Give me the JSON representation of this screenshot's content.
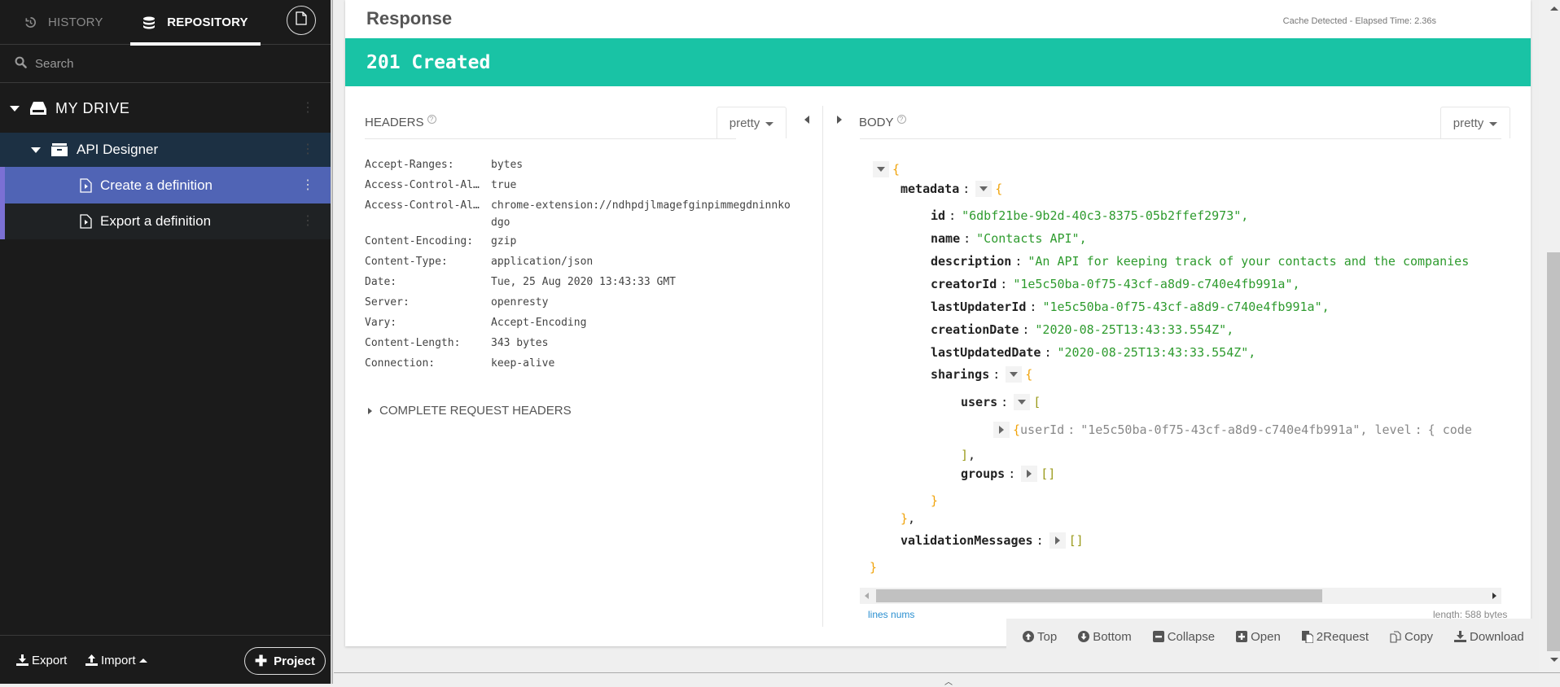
{
  "sidebar": {
    "tabs": [
      {
        "label": "HISTORY",
        "icon": "history-icon",
        "active": false
      },
      {
        "label": "REPOSITORY",
        "icon": "database-icon",
        "active": true
      }
    ],
    "new_doc_icon": "new-document-icon",
    "search": {
      "placeholder": "Search",
      "value": ""
    },
    "tree": {
      "drive": {
        "label": "MY DRIVE",
        "icon": "drive-icon",
        "expanded": true
      },
      "project": {
        "label": "API Designer",
        "icon": "project-box-icon",
        "expanded": true
      },
      "requests": [
        {
          "label": "Create a definition",
          "icon": "request-file-icon",
          "selected": true
        },
        {
          "label": "Export a definition",
          "icon": "request-file-icon",
          "selected": false
        }
      ]
    },
    "footer": {
      "export_label": "Export",
      "import_label": "Import",
      "project_label": "Project"
    }
  },
  "response": {
    "title": "Response",
    "elapsed": "Cache Detected - Elapsed Time: 2.36s",
    "status": "201 Created",
    "status_color": "#19c3a5",
    "headers": {
      "title": "HEADERS",
      "format": "pretty",
      "rows": [
        {
          "key": "Accept-Ranges:",
          "value": "bytes"
        },
        {
          "key": "Access-Control-Al…",
          "value": "true"
        },
        {
          "key": "Access-Control-Al…",
          "value": "chrome-extension://ndhpdjlmagefginpimmegdninnkodgo"
        },
        {
          "key": "Content-Encoding:",
          "value": "gzip"
        },
        {
          "key": "Content-Type:",
          "value": "application/json"
        },
        {
          "key": "Date:",
          "value": "Tue, 25 Aug 2020 13:43:33 GMT"
        },
        {
          "key": "Server:",
          "value": "openresty"
        },
        {
          "key": "Vary:",
          "value": "Accept-Encoding"
        },
        {
          "key": "Content-Length:",
          "value": "343 bytes"
        },
        {
          "key": "Connection:",
          "value": "keep-alive"
        }
      ],
      "complete_request_label": "COMPLETE REQUEST HEADERS"
    },
    "body": {
      "title": "BODY",
      "format": "pretty",
      "metadata_key": "metadata",
      "fields": [
        {
          "key": "id",
          "value": "\"6dbf21be-9b2d-40c3-8375-05b2ffef2973\","
        },
        {
          "key": "name",
          "value": "\"Contacts API\","
        },
        {
          "key": "description",
          "value": "\"An API for keeping track of your contacts and the companies"
        },
        {
          "key": "creatorId",
          "value": "\"1e5c50ba-0f75-43cf-a8d9-c740e4fb991a\","
        },
        {
          "key": "lastUpdaterId",
          "value": "\"1e5c50ba-0f75-43cf-a8d9-c740e4fb991a\","
        },
        {
          "key": "creationDate",
          "value": "\"2020-08-25T13:43:33.554Z\","
        },
        {
          "key": "lastUpdatedDate",
          "value": "\"2020-08-25T13:43:33.554Z\","
        }
      ],
      "sharings_key": "sharings",
      "users_key": "users",
      "user_preview": {
        "key": "userId",
        "value": "\"1e5c50ba-0f75-43cf-a8d9-c740e4fb991a\",",
        "level_key": "level",
        "level_preview": "{ code"
      },
      "groups_key": "groups",
      "validation_key": "validationMessages",
      "lines_nums_label": "lines nums",
      "length": "length: 588 bytes"
    },
    "toolbar": [
      {
        "label": "Top",
        "icon": "arrow-up-circle-icon"
      },
      {
        "label": "Bottom",
        "icon": "arrow-down-circle-icon"
      },
      {
        "label": "Collapse",
        "icon": "minus-square-icon"
      },
      {
        "label": "Open",
        "icon": "plus-square-icon"
      },
      {
        "label": "2Request",
        "icon": "paste-request-icon"
      },
      {
        "label": "Copy",
        "icon": "copy-icon"
      },
      {
        "label": "Download",
        "icon": "download-icon"
      }
    ]
  }
}
